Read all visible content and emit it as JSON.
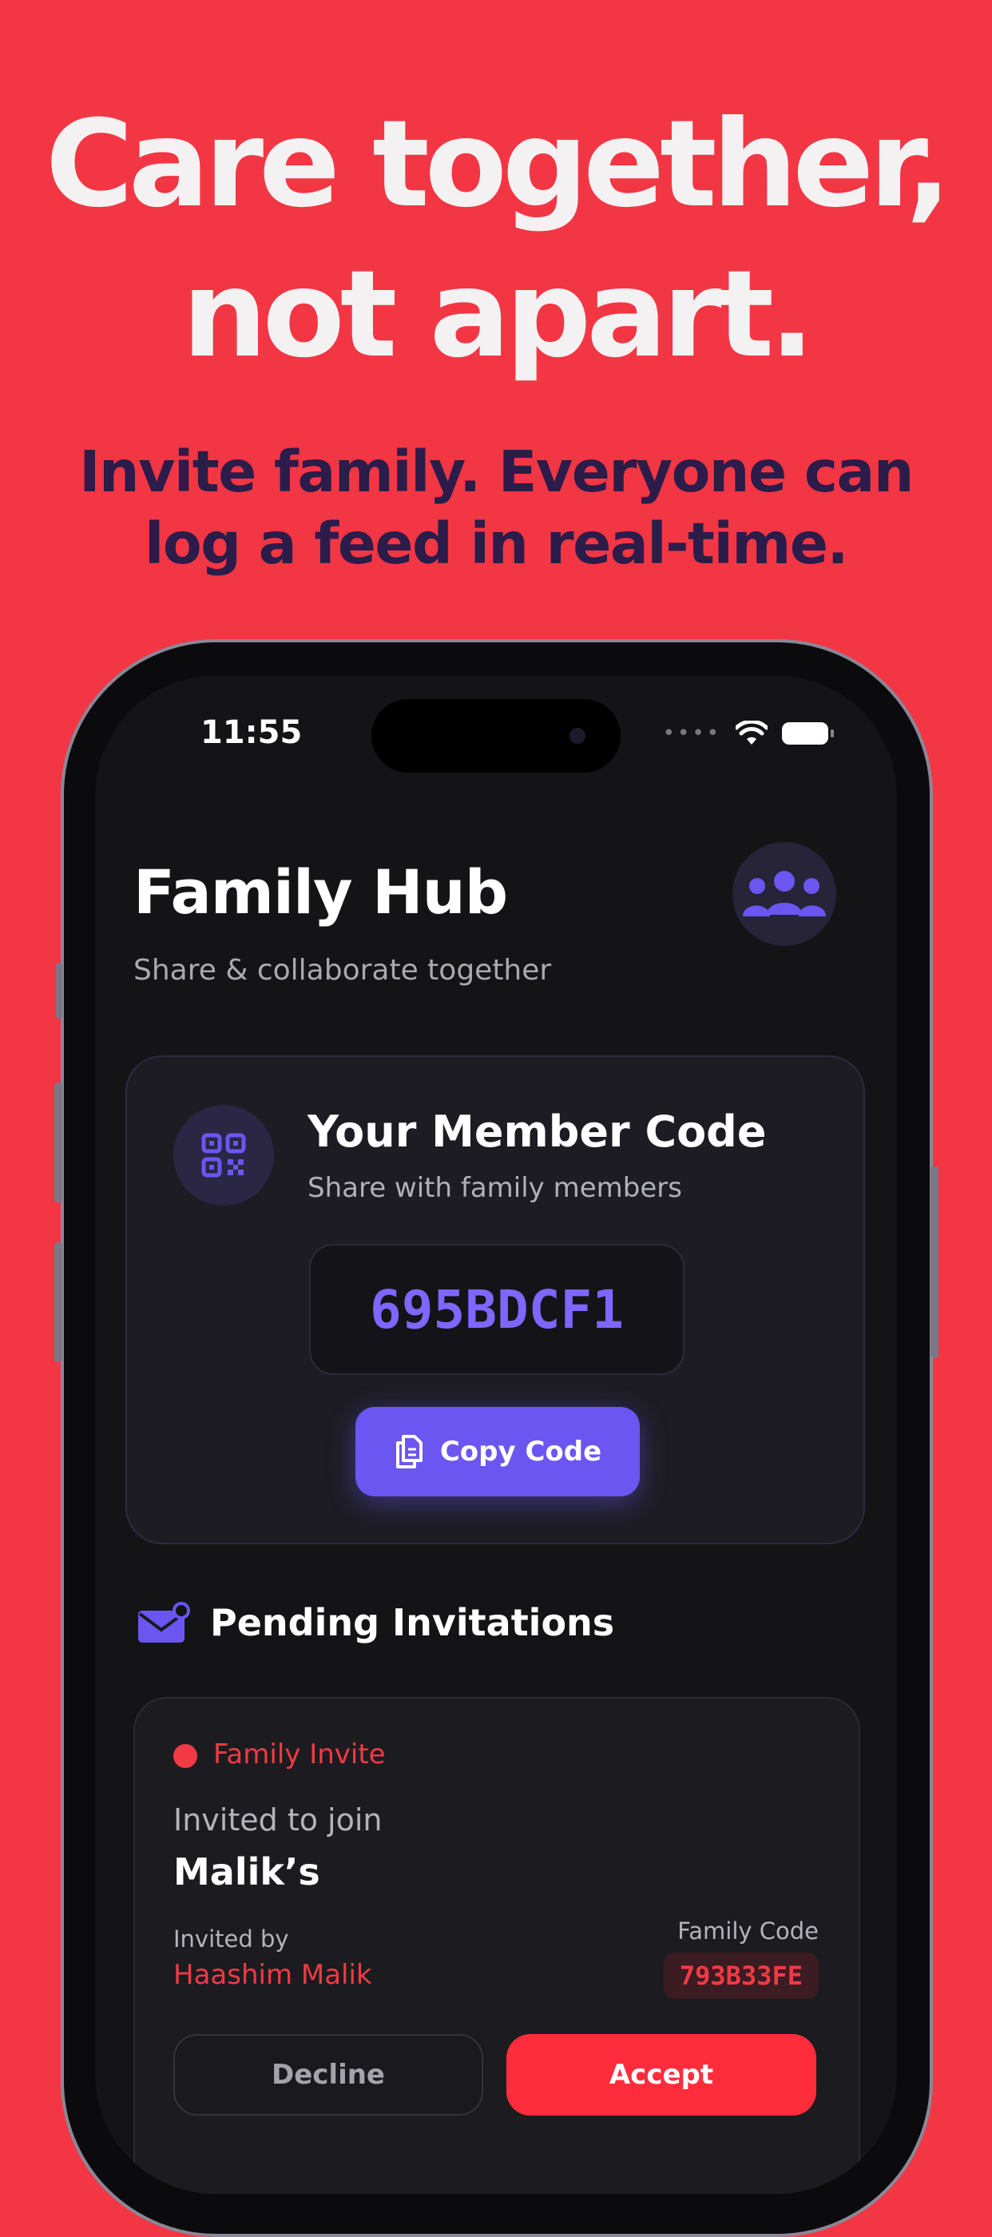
{
  "headline": {
    "line1": "Care together,",
    "line2": "not apart."
  },
  "subhead": {
    "line1": "Invite family. Everyone can",
    "line2": "log a feed in real-time."
  },
  "status_bar": {
    "time": "11:55",
    "wifi_icon": "wifi-icon",
    "battery_icon": "battery-icon"
  },
  "hub": {
    "title": "Family Hub",
    "subtitle": "Share & collaborate together",
    "avatar_icon": "family-group-icon"
  },
  "member_code": {
    "icon": "qr-code-icon",
    "title": "Your Member Code",
    "subtitle": "Share with family members",
    "code": "695BDCF1",
    "copy_label": "Copy Code",
    "copy_icon": "copy-icon"
  },
  "pending": {
    "icon": "envelope-icon",
    "title": "Pending Invitations",
    "invites": [
      {
        "type_label": "Family Invite",
        "invited_to_label": "Invited to join",
        "family_name": "Malik’s",
        "invited_by_label": "Invited by",
        "inviter": "Haashim Malik",
        "family_code_label": "Family Code",
        "family_code": "793B33FE",
        "decline_label": "Decline",
        "accept_label": "Accept"
      }
    ]
  },
  "colors": {
    "background": "#f33644",
    "accent_purple": "#6b56f2",
    "accent_red": "#f23a45",
    "subhead": "#2b1c4a"
  }
}
